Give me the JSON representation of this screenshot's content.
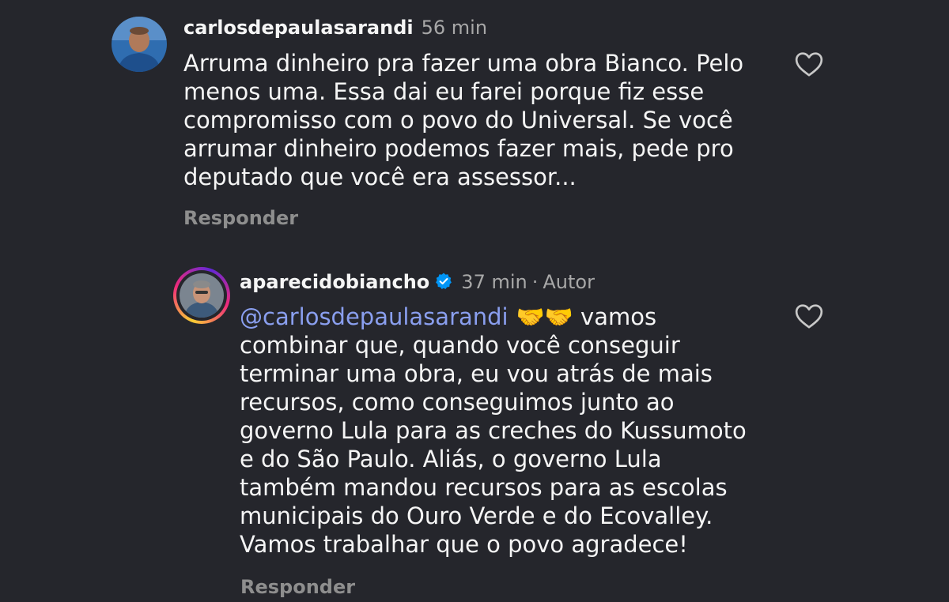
{
  "comments": [
    {
      "username": "carlosdepaulasarandi",
      "time": "56 min",
      "text": "Arruma dinheiro pra fazer uma obra Bianco. Pelo\nmenos uma. Essa dai eu farei  porque fiz esse\ncompromisso com o povo do Universal. Se você\narrumar dinheiro podemos fazer mais, pede pro\ndeputado que você era assessor...",
      "reply_label": "Responder",
      "like_icon": "heart-outline-icon"
    },
    {
      "username": "aparecidobiancho",
      "verified": true,
      "time": "37 min",
      "separator": "·",
      "author_label": "Autor",
      "mention": "@carlosdepaulasarandi",
      "emoji": "🤝🤝",
      "text_first_line": " vamos",
      "text": "combinar que, quando você conseguir\nterminar uma obra, eu vou atrás de mais\nrecursos, como conseguimos junto ao\ngoverno Lula para as creches do Kussumoto\ne do São Paulo. Aliás, o governo Lula\ntambém mandou recursos para as escolas\nmunicipais do Ouro Verde e do Ecovalley.\nVamos trabalhar que o povo agradece!",
      "reply_label": "Responder",
      "like_icon": "heart-outline-icon"
    }
  ],
  "colors": {
    "background": "#25262c",
    "text": "#f5f5f5",
    "meta": "#a8a8a8",
    "mention": "#8a9fef",
    "verified": "#0095f6"
  }
}
